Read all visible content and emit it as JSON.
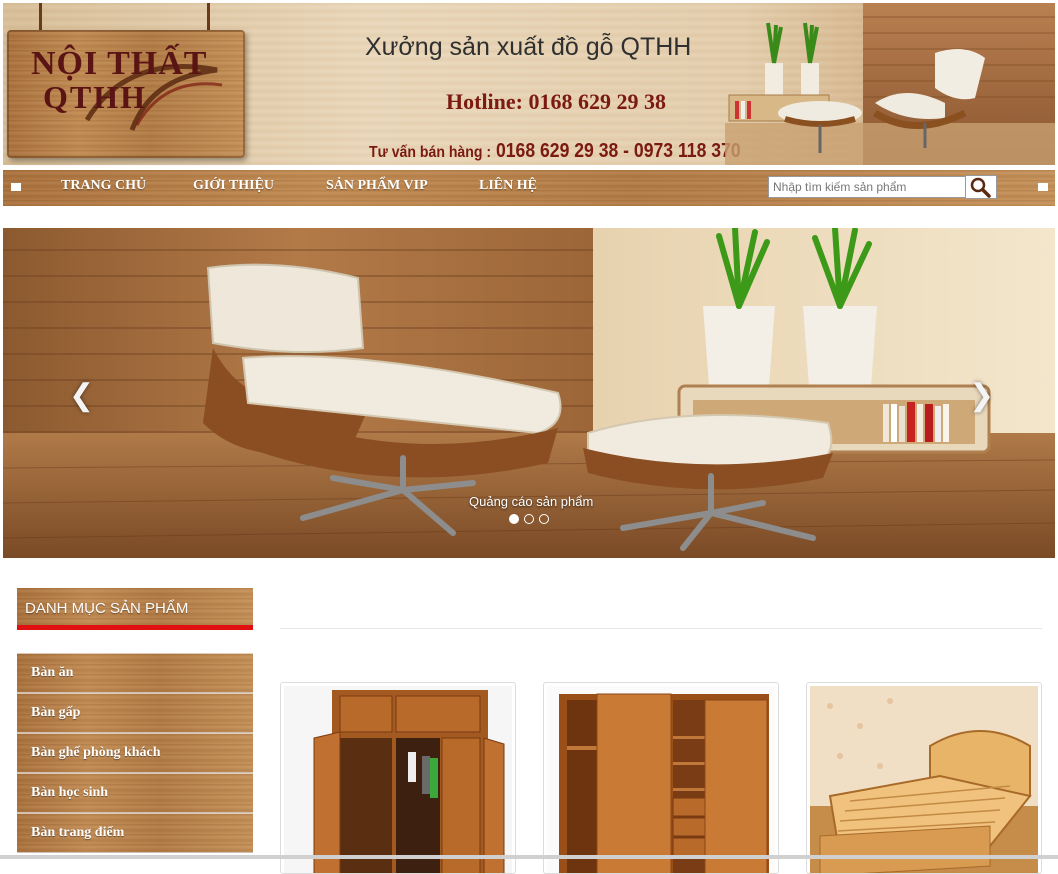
{
  "header": {
    "logo_line1": "NỘI THẤT",
    "logo_line2": "QTHH",
    "site_title": "Xưởng sản xuất đồ gỗ QTHH",
    "hotline": "Hotline: 0168 629 29 38",
    "consult_label": "Tư vấn bán hàng :",
    "consult_numbers": "0168 629 29 38 - 0973 118 370"
  },
  "nav": {
    "items": [
      {
        "label": "TRANG CHỦ"
      },
      {
        "label": "GIỚI THIỆU"
      },
      {
        "label": "SẢN PHẨM VIP"
      },
      {
        "label": "LIÊN HỆ"
      }
    ],
    "search_placeholder": "Nhập tìm kiếm sản phẩm",
    "search_icon": "magnifier-icon"
  },
  "slider": {
    "caption": "Quảng cáo sản phẩm",
    "prev_glyph": "❮",
    "next_glyph": "❯",
    "dot_count": 3,
    "active_dot": 1
  },
  "categories": {
    "title": "DANH MỤC SẢN PHẨM",
    "items": [
      {
        "label": "Bàn ăn"
      },
      {
        "label": "Bàn gấp"
      },
      {
        "label": "Bàn ghế phòng khách"
      },
      {
        "label": "Bàn học sinh"
      },
      {
        "label": "Bàn trang điểm"
      }
    ]
  },
  "colors": {
    "accent_red": "#e01010",
    "wood": "#b07a44",
    "text_dark": "#2f2f2f",
    "hotline": "#7a1a10"
  }
}
